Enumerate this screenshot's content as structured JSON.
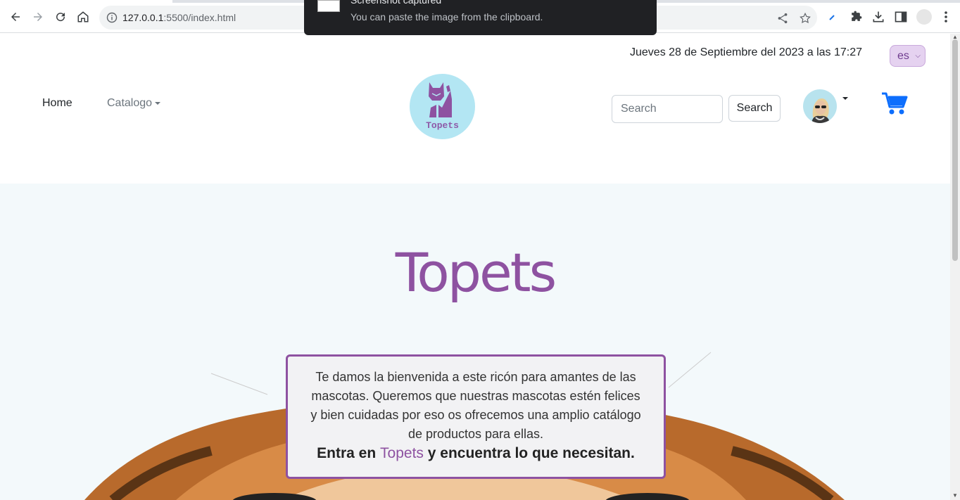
{
  "browser": {
    "url_host": "127.0.0.1",
    "url_rest": ":5500/index.html"
  },
  "toast": {
    "title": "Screenshot captured",
    "message": "You can paste the image from the clipboard."
  },
  "header": {
    "date_text": "Jueves 28 de Septiembre del 2023 a las 17:27",
    "language": "es",
    "nav": {
      "home": "Home",
      "catalog": "Catalogo"
    },
    "logo_text": "Topets",
    "search": {
      "placeholder": "Search",
      "button": "Search"
    }
  },
  "hero": {
    "title": "Topets",
    "welcome_text": "Te damos la bienvenida a este ricón para amantes de las mascotas. Queremos que nuestras mascotas estén felices y bien cuidadas por eso os ofrecemos una amplio catálogo de productos para ellas.",
    "cta_before": "Entra en",
    "cta_brand": "Topets",
    "cta_after": "y encuentra lo que necesitan."
  },
  "colors": {
    "brand": "#8e52a1",
    "logo_bg": "#b3e6f3",
    "cart": "#0d6efd",
    "hero_bg": "#f3f9fb"
  }
}
